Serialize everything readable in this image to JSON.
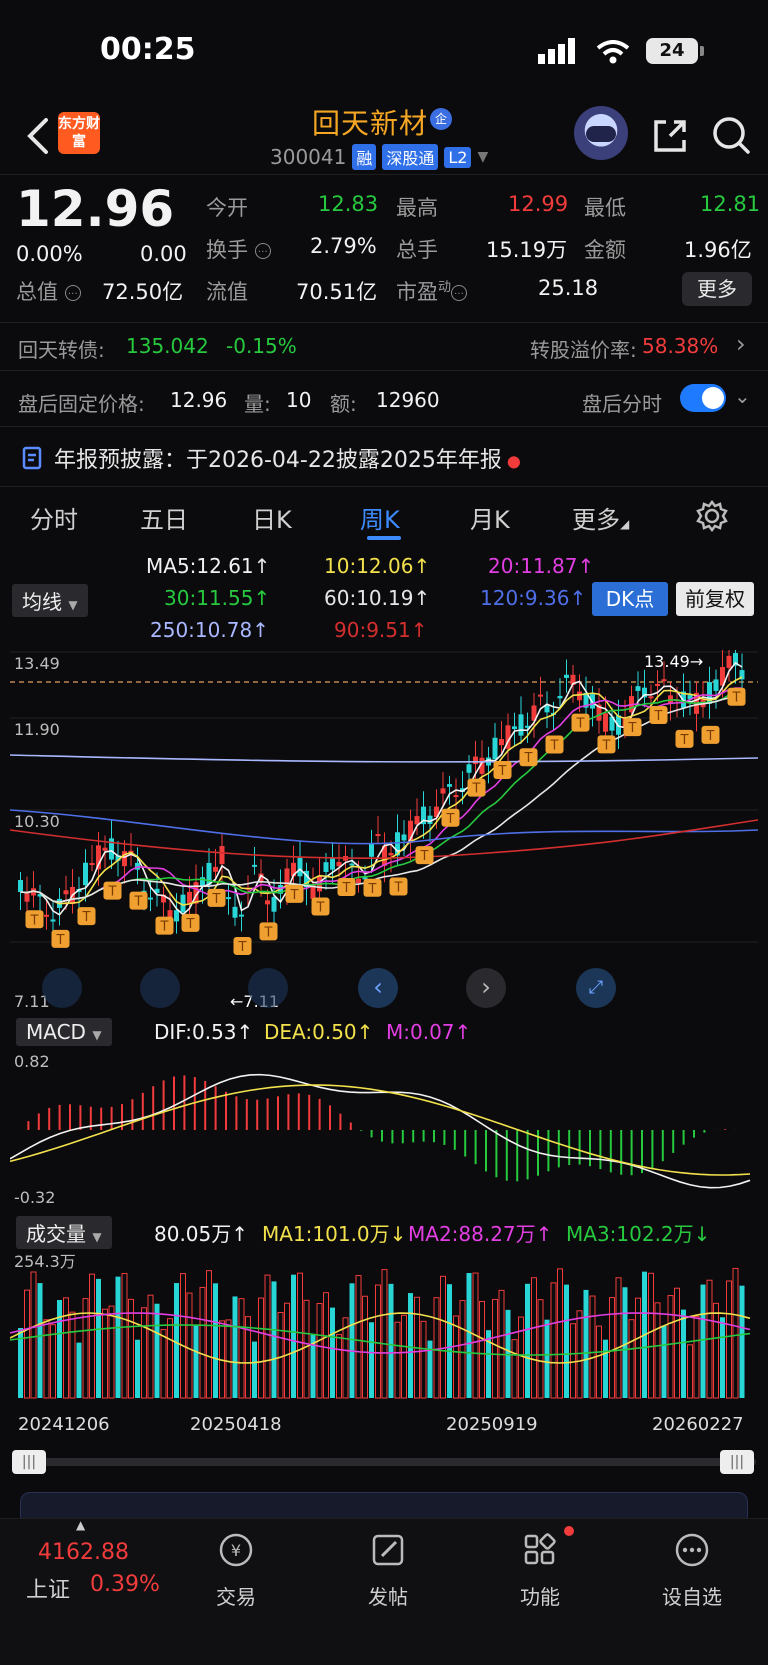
{
  "status": {
    "time": "00:25",
    "battery": "24"
  },
  "header": {
    "brand": "东方财富",
    "stock_name": "回天新材",
    "ent_badge": "企",
    "stock_code": "300041",
    "tags": [
      "融",
      "深股通",
      "L2"
    ]
  },
  "quote": {
    "price": "12.96",
    "change_pct": "0.00%",
    "change": "0.00",
    "cells": [
      {
        "label": "今开",
        "value": "12.83"
      },
      {
        "label": "最高",
        "value": "12.99"
      },
      {
        "label": "最低",
        "value": "12.81"
      },
      {
        "label": "换手",
        "value": "2.79%"
      },
      {
        "label": "总手",
        "value": "15.19万"
      },
      {
        "label": "金额",
        "value": "1.96亿"
      },
      {
        "label": "总值",
        "value": "72.50亿"
      },
      {
        "label": "流值",
        "value": "70.51亿"
      },
      {
        "label": "市盈",
        "value": "25.18"
      }
    ],
    "pe_sup": "动",
    "more_label": "更多"
  },
  "bond": {
    "label": "回天转债:",
    "price": "135.042",
    "change": "-0.15%",
    "premium_label": "转股溢价率:",
    "premium_value": "58.38%"
  },
  "after_hours": {
    "label": "盘后固定价格:",
    "price": "12.96",
    "vol_label": "量:",
    "vol": "10",
    "amt_label": "额:",
    "amt": "12960",
    "toggle_label": "盘后分时"
  },
  "notice": {
    "text": "年报预披露：于2026-04-22披露2025年年报"
  },
  "tabs": [
    "分时",
    "五日",
    "日K",
    "周K",
    "月K",
    "更多"
  ],
  "active_tab": "周K",
  "ma_legend": {
    "selector": "均线",
    "items": [
      {
        "text": "MA5:12.61",
        "color": "#f2f2f2"
      },
      {
        "text": "10:12.06",
        "color": "#f2e14c"
      },
      {
        "text": "20:11.87",
        "color": "#e23fe2"
      },
      {
        "text": "30:11.55",
        "color": "#27c93f"
      },
      {
        "text": "60:10.19",
        "color": "#e6e6e6"
      },
      {
        "text": "120:9.36",
        "color": "#4f6fe8"
      },
      {
        "text": "250:10.78",
        "color": "#a9b8ff"
      },
      {
        "text": "90:9.51",
        "color": "#d32f2f"
      }
    ],
    "dk_label": "DK点",
    "fq_label": "前复权"
  },
  "kchart": {
    "y_labels": [
      "13.49",
      "11.90",
      "10.30",
      "7.11"
    ],
    "high_marker": "13.49",
    "low_marker": "7.11",
    "colors": {
      "up": "#f23c3c",
      "down": "#29d6d6"
    }
  },
  "macd": {
    "selector": "MACD",
    "dif": "DIF:0.53",
    "dea": "DEA:0.50",
    "m": "M:0.07",
    "y_top": "0.82",
    "y_bottom": "-0.32"
  },
  "volume": {
    "selector": "成交量",
    "vol": "80.05万",
    "ma1": "MA1:101.0万",
    "ma2": "MA2:88.27万",
    "ma3": "MA3:102.2万",
    "y_top": "254.3万",
    "dates": [
      "20241206",
      "20250418",
      "20250919",
      "20260227"
    ]
  },
  "bottom_nav": {
    "index_value": "4162.88",
    "index_name": "上证",
    "index_change": "0.39%",
    "items": [
      "交易",
      "发帖",
      "功能",
      "设自选"
    ]
  }
}
